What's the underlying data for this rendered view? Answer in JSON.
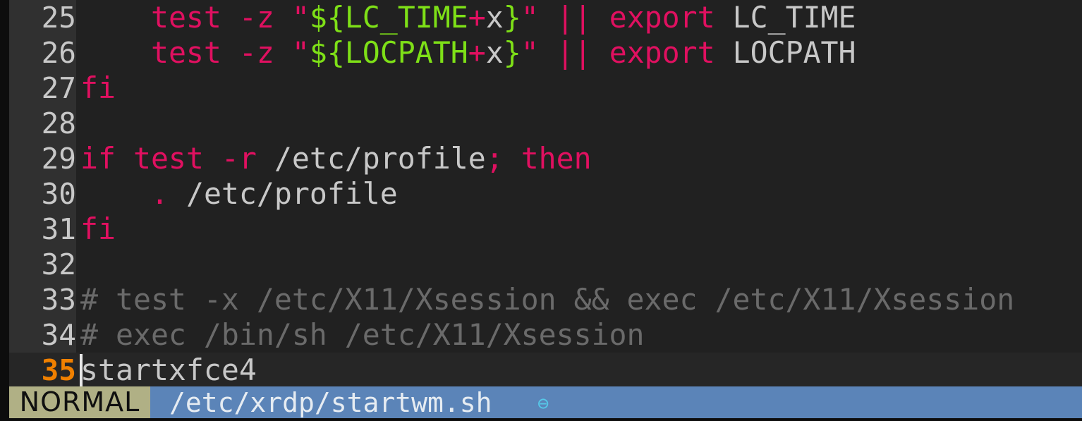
{
  "editor": {
    "app": "vim",
    "colors": {
      "background": "#212121",
      "current_line_background": "#262626",
      "gutter_background": "#303030",
      "sign_column": "#0d0d0d",
      "line_number": "#c8c8c8",
      "current_line_number": "#f08000",
      "keyword": "#e01060",
      "string_expansion": "#7ee017",
      "identifier": "#c8c8c8",
      "comment": "#6a6a6a",
      "cursor": "#e8e8e8",
      "status_mode_bg": "#b0b085",
      "status_mode_fg": "#101010",
      "status_bg": "#5b84b8",
      "status_fg": "#e6ecf2",
      "status_flag": "#56c8e8"
    },
    "cursor_line": 35,
    "cursor_column": 1,
    "lines": [
      {
        "number": "25",
        "current": false,
        "tokens": [
          {
            "cls": "plain",
            "text": "    "
          },
          {
            "cls": "kw",
            "text": "test -z "
          },
          {
            "cls": "str",
            "text": "\""
          },
          {
            "cls": "var",
            "text": "${LC_TIME"
          },
          {
            "cls": "str",
            "text": "+"
          },
          {
            "cls": "ident",
            "text": "x"
          },
          {
            "cls": "var",
            "text": "}"
          },
          {
            "cls": "str",
            "text": "\""
          },
          {
            "cls": "plain",
            "text": " "
          },
          {
            "cls": "kw",
            "text": "||"
          },
          {
            "cls": "plain",
            "text": " "
          },
          {
            "cls": "kw",
            "text": "export"
          },
          {
            "cls": "plain",
            "text": " "
          },
          {
            "cls": "ident",
            "text": "LC_TIME"
          }
        ]
      },
      {
        "number": "26",
        "current": false,
        "tokens": [
          {
            "cls": "plain",
            "text": "    "
          },
          {
            "cls": "kw",
            "text": "test -z "
          },
          {
            "cls": "str",
            "text": "\""
          },
          {
            "cls": "var",
            "text": "${LOCPATH"
          },
          {
            "cls": "str",
            "text": "+"
          },
          {
            "cls": "ident",
            "text": "x"
          },
          {
            "cls": "var",
            "text": "}"
          },
          {
            "cls": "str",
            "text": "\""
          },
          {
            "cls": "plain",
            "text": " "
          },
          {
            "cls": "kw",
            "text": "||"
          },
          {
            "cls": "plain",
            "text": " "
          },
          {
            "cls": "kw",
            "text": "export"
          },
          {
            "cls": "plain",
            "text": " "
          },
          {
            "cls": "ident",
            "text": "LOCPATH"
          }
        ]
      },
      {
        "number": "27",
        "current": false,
        "tokens": [
          {
            "cls": "kw",
            "text": "fi"
          }
        ]
      },
      {
        "number": "28",
        "current": false,
        "tokens": []
      },
      {
        "number": "29",
        "current": false,
        "tokens": [
          {
            "cls": "kw",
            "text": "if test -r"
          },
          {
            "cls": "plain",
            "text": " "
          },
          {
            "cls": "ident",
            "text": "/etc/profile"
          },
          {
            "cls": "kw",
            "text": ";"
          },
          {
            "cls": "plain",
            "text": " "
          },
          {
            "cls": "kw",
            "text": "then"
          }
        ]
      },
      {
        "number": "30",
        "current": false,
        "tokens": [
          {
            "cls": "plain",
            "text": "    "
          },
          {
            "cls": "kw",
            "text": "."
          },
          {
            "cls": "plain",
            "text": " "
          },
          {
            "cls": "ident",
            "text": "/etc/profile"
          }
        ]
      },
      {
        "number": "31",
        "current": false,
        "tokens": [
          {
            "cls": "kw",
            "text": "fi"
          }
        ]
      },
      {
        "number": "32",
        "current": false,
        "tokens": []
      },
      {
        "number": "33",
        "current": false,
        "tokens": [
          {
            "cls": "cmt",
            "text": "# test -x /etc/X11/Xsession && exec /etc/X11/Xsession"
          }
        ]
      },
      {
        "number": "34",
        "current": false,
        "tokens": [
          {
            "cls": "cmt",
            "text": "# exec /bin/sh /etc/X11/Xsession"
          }
        ]
      },
      {
        "number": "35",
        "current": true,
        "tokens": [
          {
            "cls": "ident",
            "text": "startxfce4"
          }
        ]
      }
    ]
  },
  "statusline": {
    "mode": "NORMAL",
    "filename": "/etc/xrdp/startwm.sh",
    "modified_flag": "⊖",
    "modified_flag_name": "readonly-circle-minus-icon"
  }
}
